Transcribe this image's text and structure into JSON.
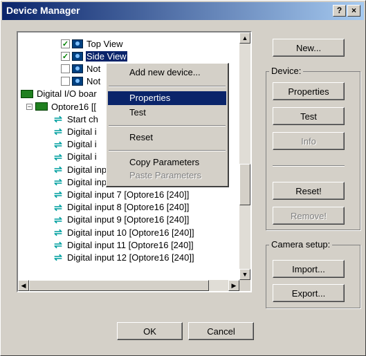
{
  "window": {
    "title": "Device Manager",
    "help_label": "?",
    "close_label": "×"
  },
  "tree": {
    "items": [
      {
        "label": "Top View",
        "checked": true,
        "icon": "camera-icon"
      },
      {
        "label": "Side View",
        "checked": true,
        "icon": "camera-icon",
        "selected": true
      },
      {
        "label": "Not",
        "checked": false,
        "icon": "camera-icon"
      },
      {
        "label": "Not",
        "checked": false,
        "icon": "camera-icon"
      },
      {
        "label": "Digital I/O boar",
        "icon": "io-board-icon"
      },
      {
        "label": "Optore16 [[",
        "icon": "io-board-icon",
        "expander": "−"
      },
      {
        "label": "Start ch",
        "icon": "digital-io-icon"
      },
      {
        "label": "Digital i",
        "icon": "digital-io-icon"
      },
      {
        "label": "Digital i",
        "icon": "digital-io-icon"
      },
      {
        "label": "Digital i",
        "icon": "digital-io-icon"
      },
      {
        "label": "Digital input 5 [Optore16 [240]]",
        "icon": "digital-io-icon"
      },
      {
        "label": "Digital input 6 [Optore16 [240]]",
        "icon": "digital-io-icon"
      },
      {
        "label": "Digital input 7 [Optore16 [240]]",
        "icon": "digital-io-icon"
      },
      {
        "label": "Digital input 8 [Optore16 [240]]",
        "icon": "digital-io-icon"
      },
      {
        "label": "Digital input 9 [Optore16 [240]]",
        "icon": "digital-io-icon"
      },
      {
        "label": "Digital input 10 [Optore16 [240]]",
        "icon": "digital-io-icon"
      },
      {
        "label": "Digital input 11 [Optore16 [240]]",
        "icon": "digital-io-icon"
      },
      {
        "label": "Digital input 12 [Optore16 [240]]",
        "icon": "digital-io-icon"
      }
    ]
  },
  "context_menu": {
    "items": [
      {
        "label": "Add new device...",
        "ul": "A"
      },
      {
        "label": "Properties",
        "ul": "P",
        "highlighted": true
      },
      {
        "label": "Test",
        "ul": "T"
      },
      {
        "label": "Reset",
        "ul": "R"
      },
      {
        "label": "Copy Parameters",
        "ul": "o"
      },
      {
        "label": "Paste Parameters",
        "ul": "P",
        "disabled": true
      }
    ]
  },
  "panel": {
    "new_label": "New...",
    "device_group": "Device:",
    "properties_label": "Properties",
    "test_label": "Test",
    "info_label": "Info",
    "reset_label": "Reset!",
    "remove_label": "Remove!",
    "camera_group": "Camera setup:",
    "import_label": "Import...",
    "export_label": "Export..."
  },
  "footer": {
    "ok_label": "OK",
    "cancel_label": "Cancel"
  },
  "colors": {
    "title_start": "#0a246a",
    "title_end": "#a6caf0",
    "selection": "#0a246a",
    "face": "#d4d0c8"
  }
}
